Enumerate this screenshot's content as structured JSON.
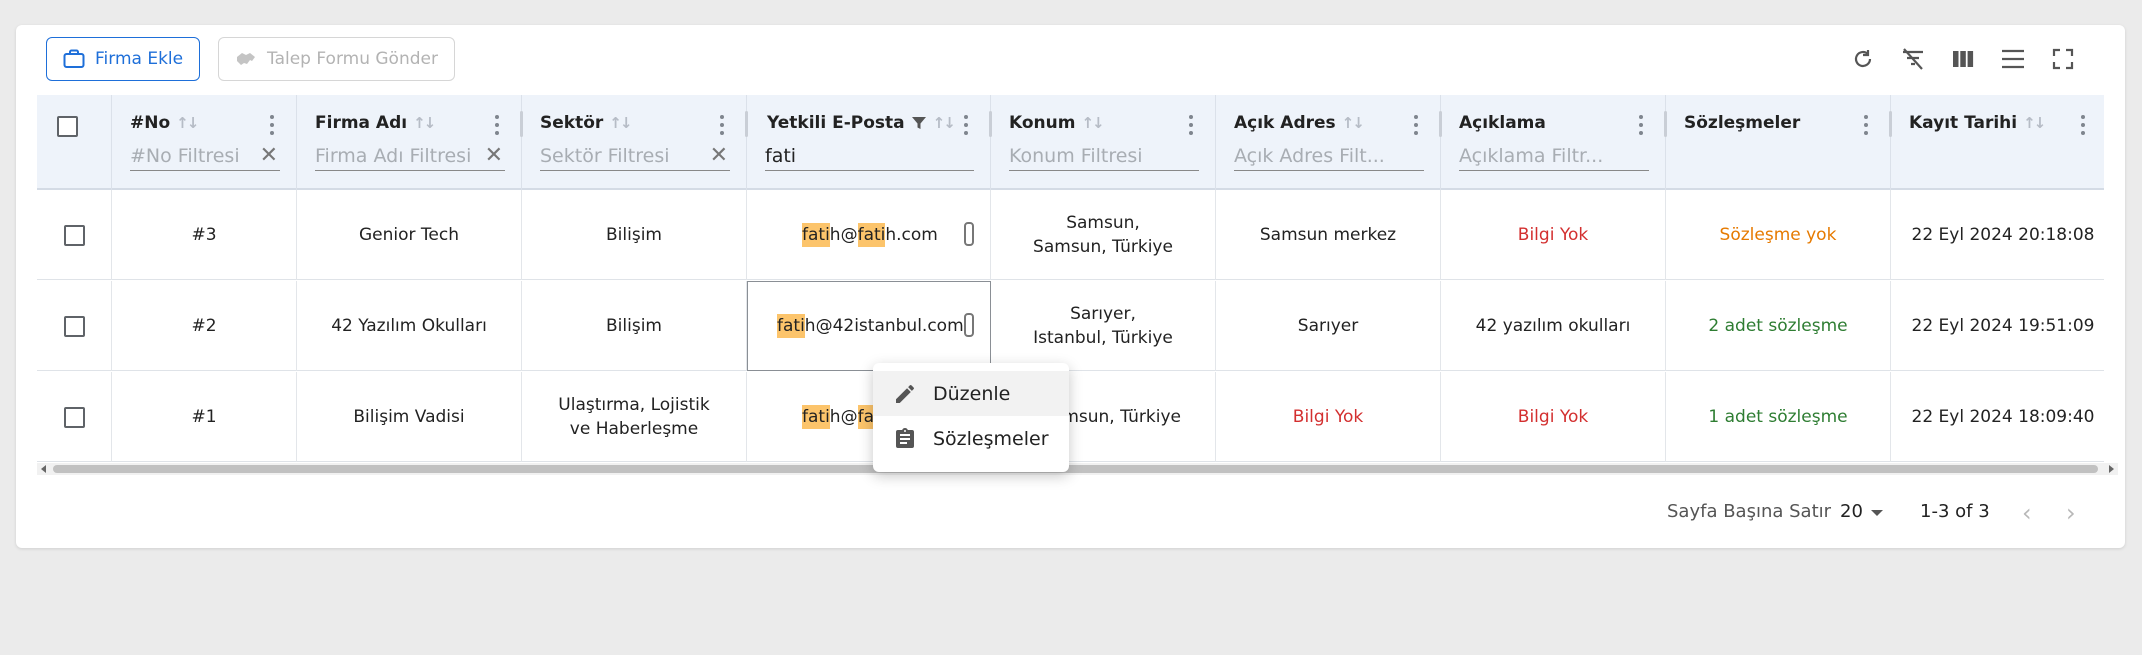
{
  "toolbar": {
    "add_company_label": "Firma Ekle",
    "send_request_label": "Talep Formu Gönder"
  },
  "columns": [
    {
      "title": "#No",
      "filter_placeholder": "#No Filtresi",
      "filter_value": ""
    },
    {
      "title": "Firma Adı",
      "filter_placeholder": "Firma Adı Filtresi",
      "filter_value": ""
    },
    {
      "title": "Sektör",
      "filter_placeholder": "Sektör Filtresi",
      "filter_value": ""
    },
    {
      "title": "Yetkili E-Posta",
      "filter_placeholder": "",
      "filter_value": "fati"
    },
    {
      "title": "Konum",
      "filter_placeholder": "Konum Filtresi",
      "filter_value": ""
    },
    {
      "title": "Açık Adres",
      "filter_placeholder": "Açık Adres Filt...",
      "filter_value": ""
    },
    {
      "title": "Açıklama",
      "filter_placeholder": "Açıklama Filtr...",
      "filter_value": ""
    },
    {
      "title": "Sözleşmeler",
      "filter_placeholder": "",
      "filter_value": ""
    },
    {
      "title": "Kayıt Tarihi",
      "filter_placeholder": "",
      "filter_value": ""
    }
  ],
  "rows": [
    {
      "no": "#3",
      "firma": "Genior Tech",
      "sektor": "Bilişim",
      "email_a": "fati",
      "email_b": "h@",
      "email_c": "fati",
      "email_d": "h.com",
      "konum": "Samsun, Samsun, Türkiye",
      "adres": "Samsun merkez",
      "aciklama": "Bilgi Yok",
      "sozlesme": "Sözleşme yok",
      "tarih": "22 Eyl 2024 20:18:08"
    },
    {
      "no": "#2",
      "firma": "42 Yazılım Okulları",
      "sektor": "Bilişim",
      "email_a": "fati",
      "email_b": "h@42istanbul.com",
      "email_c": "",
      "email_d": "",
      "konum": "Sarıyer, Istanbul, Türkiye",
      "adres": "Sarıyer",
      "aciklama": "42 yazılım okulları",
      "sozlesme": "2 adet sözleşme",
      "tarih": "22 Eyl 2024 19:51:09"
    },
    {
      "no": "#1",
      "firma": "Bilişim Vadisi",
      "sektor": "Ulaştırma, Lojistik ve Haberleşme",
      "email_a": "fati",
      "email_b": "h@",
      "email_c": "fa",
      "email_d": "",
      "konum": "Samsun, Türkiye",
      "adres": "Bilgi Yok",
      "aciklama": "Bilgi Yok",
      "sozlesme": "1 adet sözleşme",
      "tarih": "22 Eyl 2024 18:09:40"
    }
  ],
  "context_menu": {
    "edit_label": "Düzenle",
    "contracts_label": "Sözleşmeler"
  },
  "pagination": {
    "rows_per_page_label": "Sayfa Başına Satır",
    "rows_per_page_value": "20",
    "range_label": "1-3 of 3"
  },
  "colors": {
    "accent": "#1e6fd9",
    "highlight": "#fcc46b",
    "no_info": "#d32f2f",
    "no_contract": "#e67a00",
    "has_contract": "#2e7d32"
  }
}
